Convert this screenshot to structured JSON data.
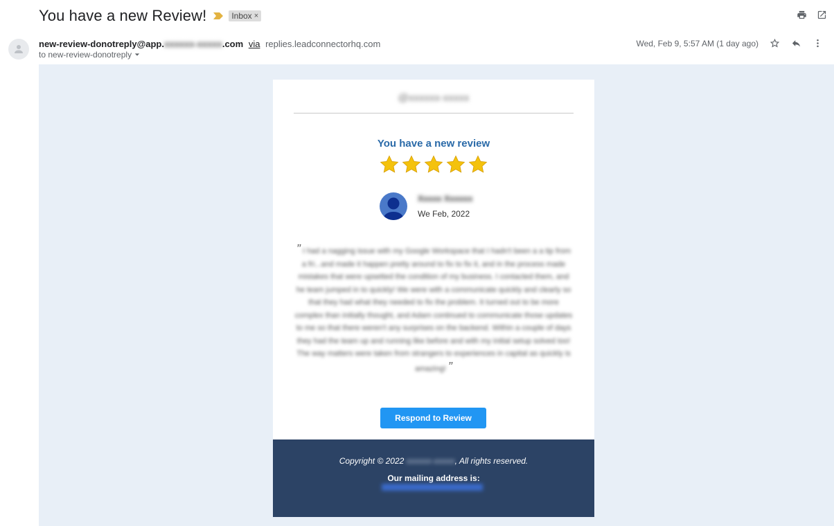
{
  "email": {
    "subject": "You have a new Review!",
    "label_chip": "Inbox",
    "label_close": "×",
    "sender_prefix": "new-review-donotreply@app.",
    "sender_redacted": "xxxxxx-xxxxx",
    "sender_suffix": ".com",
    "via_label": "via",
    "via_domain": "replies.leadconnectorhq.com",
    "to_line": "to new-review-donotreply",
    "timestamp": "Wed, Feb 9, 5:57 AM (1 day ago)"
  },
  "card": {
    "brand_redacted": "@xxxxxx-xxxxx",
    "headline": "You have a new review",
    "rating": 5,
    "reviewer_name_redacted": "Xxxxx Xxxxxx",
    "review_date": "We Feb, 2022",
    "quote_open": "”",
    "quote_close": "”",
    "quote_lines_redacted": [
      "I had a nagging issue with my Google Workspace that I hadn't been a",
      "a tip from a fri...and made it happen pretty around to fix to fix it, and in",
      "the process made mistakes that were upsetted the condition of my",
      "business. I contacted them, and he team jumped in to quickly! We were",
      "with a communicate quickly and clearly so that they had what they",
      "needed to fix the problem. It turned out to be more complex than initially",
      "thought, and Adam continued to communicate those updates to me so that",
      "there weren't any surprises on the backend. Within a couple of days they",
      "had the team up and running like before and with my initial setup solved",
      "too! The way matters were taken from strangers to experiences in capital",
      "as quickly is amazing!"
    ],
    "respond_button": "Respond to Review"
  },
  "footer": {
    "copyright_prefix": "Copyright © 2022 ",
    "company_redacted": "xxxxxx-xxxxx",
    "copyright_suffix": ", All rights reserved.",
    "mailing_label": "Our mailing address is:"
  },
  "colors": {
    "headline": "#2a6aa8",
    "star": "#f4c20d",
    "button": "#2196f3",
    "footer_bg": "#2c4365",
    "mail_bg": "#e8eff7"
  },
  "icons": [
    "importance-marker-icon",
    "print-icon",
    "open-in-new-window-icon",
    "default-avatar-icon",
    "dropdown-arrow-icon",
    "star-icon",
    "reply-icon",
    "more-vertical-icon",
    "rating-star-icon",
    "reviewer-avatar-icon"
  ]
}
